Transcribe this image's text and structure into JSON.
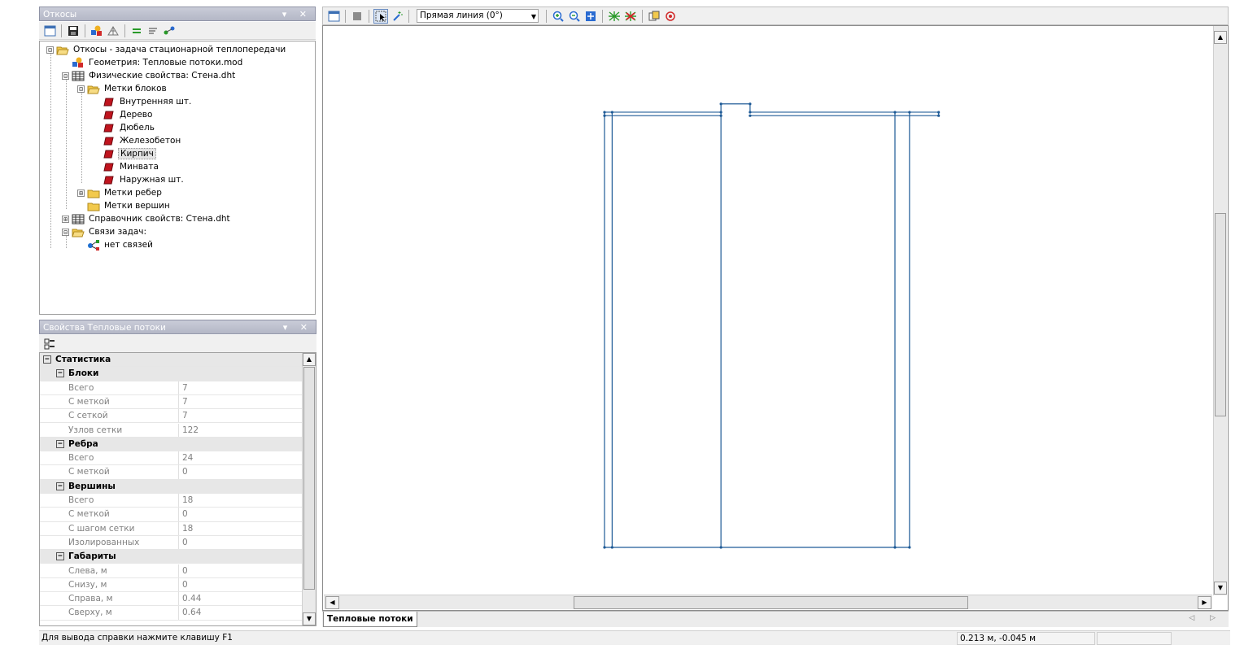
{
  "colors": {
    "pane_title_bg": "#b8bbca",
    "drawing_line": "#1e5a96",
    "block_label_icon": "#c0141e",
    "folder": "#f2c94c"
  },
  "tree_pane": {
    "title": "Откосы",
    "title_controls": "▾ ✕",
    "toolbar_icons": [
      "new-view-icon",
      "save-icon",
      "geometry-icon",
      "mesh-icon",
      "equals-icon",
      "filter-icon",
      "link-icon"
    ],
    "items": [
      {
        "label": "Откосы - задача стационарной теплопередачи",
        "icon": "folder-open-icon",
        "expander": "⊟"
      },
      {
        "label": "Геометрия: Тепловые потоки.mod",
        "icon": "geometry-icon"
      },
      {
        "label": "Физические свойства: Стена.dht",
        "icon": "table-icon",
        "expander": "⊟"
      },
      {
        "label": "Метки блоков",
        "icon": "folder-open-icon",
        "expander": "⊟"
      },
      {
        "label": "Внутренняя шт.",
        "icon": "block-label-icon"
      },
      {
        "label": "Дерево",
        "icon": "block-label-icon"
      },
      {
        "label": "Дюбель",
        "icon": "block-label-icon"
      },
      {
        "label": "Железобетон",
        "icon": "block-label-icon"
      },
      {
        "label": "Кирпич",
        "icon": "block-label-icon",
        "selected": true
      },
      {
        "label": "Минвата",
        "icon": "block-label-icon"
      },
      {
        "label": "Наружная шт.",
        "icon": "block-label-icon"
      },
      {
        "label": "Метки ребер",
        "icon": "folder-icon",
        "expander": "⊞"
      },
      {
        "label": "Метки вершин",
        "icon": "folder-icon"
      },
      {
        "label": "Справочник свойств: Стена.dht",
        "icon": "table-icon",
        "expander": "⊞"
      },
      {
        "label": "Связи задач:",
        "icon": "folder-open-icon",
        "expander": "⊟"
      },
      {
        "label": "нет связей",
        "icon": "link-node-icon"
      }
    ]
  },
  "props_pane": {
    "title": "Свойства Тепловые потоки",
    "title_controls": "▾ ✕",
    "rows": [
      {
        "kind": "cat",
        "level": 0,
        "label": "Статистика"
      },
      {
        "kind": "cat",
        "level": 1,
        "label": "Блоки"
      },
      {
        "kind": "prop",
        "name": "Всего",
        "value": "7"
      },
      {
        "kind": "prop",
        "name": "С меткой",
        "value": "7"
      },
      {
        "kind": "prop",
        "name": "С сеткой",
        "value": "7"
      },
      {
        "kind": "prop",
        "name": "Узлов сетки",
        "value": "122"
      },
      {
        "kind": "cat",
        "level": 1,
        "label": "Ребра"
      },
      {
        "kind": "prop",
        "name": "Всего",
        "value": "24"
      },
      {
        "kind": "prop",
        "name": "С меткой",
        "value": "0"
      },
      {
        "kind": "cat",
        "level": 1,
        "label": "Вершины"
      },
      {
        "kind": "prop",
        "name": "Всего",
        "value": "18"
      },
      {
        "kind": "prop",
        "name": "С меткой",
        "value": "0"
      },
      {
        "kind": "prop",
        "name": "С шагом сетки",
        "value": "18"
      },
      {
        "kind": "prop",
        "name": "Изолированных",
        "value": "0"
      },
      {
        "kind": "cat",
        "level": 1,
        "label": "Габариты"
      },
      {
        "kind": "prop",
        "name": "Слева, м",
        "value": "0"
      },
      {
        "kind": "prop",
        "name": "Снизу, м",
        "value": "0"
      },
      {
        "kind": "prop",
        "name": "Справа, м",
        "value": "0.44"
      },
      {
        "kind": "prop",
        "name": "Сверху, м",
        "value": "0.64"
      }
    ]
  },
  "view_toolbar": {
    "icons_left": [
      "view-window-icon",
      "shaded-icon",
      "select-icon",
      "magic-select-icon"
    ],
    "line_mode": "Прямая линия (0°)",
    "icons_right": [
      "zoom-in-icon",
      "zoom-out-icon",
      "zoom-fit-icon",
      "mesh-build-icon",
      "mesh-delete-icon",
      "copy-icon",
      "snap-icon"
    ]
  },
  "drawing": {
    "segments": [
      [
        0,
        0,
        0.44,
        0
      ],
      [
        0,
        0,
        0,
        0.628
      ],
      [
        0.011,
        0,
        0.011,
        0.628
      ],
      [
        0.168,
        0,
        0.168,
        0.64
      ],
      [
        0.419,
        0,
        0.419,
        0.628
      ],
      [
        0.44,
        0,
        0.44,
        0.628
      ],
      [
        0,
        0.628,
        0.168,
        0.628
      ],
      [
        0,
        0.623,
        0.168,
        0.623
      ],
      [
        0.168,
        0.64,
        0.21,
        0.64
      ],
      [
        0.21,
        0.628,
        0.21,
        0.64
      ],
      [
        0.21,
        0.628,
        0.482,
        0.628
      ],
      [
        0.21,
        0.623,
        0.482,
        0.623
      ],
      [
        0.482,
        0.623,
        0.482,
        0.628
      ]
    ],
    "vertices": [
      [
        0,
        0
      ],
      [
        0.011,
        0
      ],
      [
        0.168,
        0
      ],
      [
        0.419,
        0
      ],
      [
        0.44,
        0
      ],
      [
        0,
        0.628
      ],
      [
        0.011,
        0.628
      ],
      [
        0.168,
        0.628
      ],
      [
        0.419,
        0.628
      ],
      [
        0.44,
        0.628
      ],
      [
        0,
        0.623
      ],
      [
        0.168,
        0.64
      ],
      [
        0.21,
        0.64
      ],
      [
        0.21,
        0.628
      ],
      [
        0.21,
        0.623
      ],
      [
        0.482,
        0.628
      ],
      [
        0.482,
        0.623
      ],
      [
        0.168,
        0.623
      ]
    ]
  },
  "tabs": [
    {
      "label": "Тепловые потоки",
      "active": true
    }
  ],
  "tab_nav": "◁ ▷",
  "status": {
    "help": "Для вывода справки нажмите клавишу F1",
    "coords": "0.213 м, -0.045 м"
  }
}
